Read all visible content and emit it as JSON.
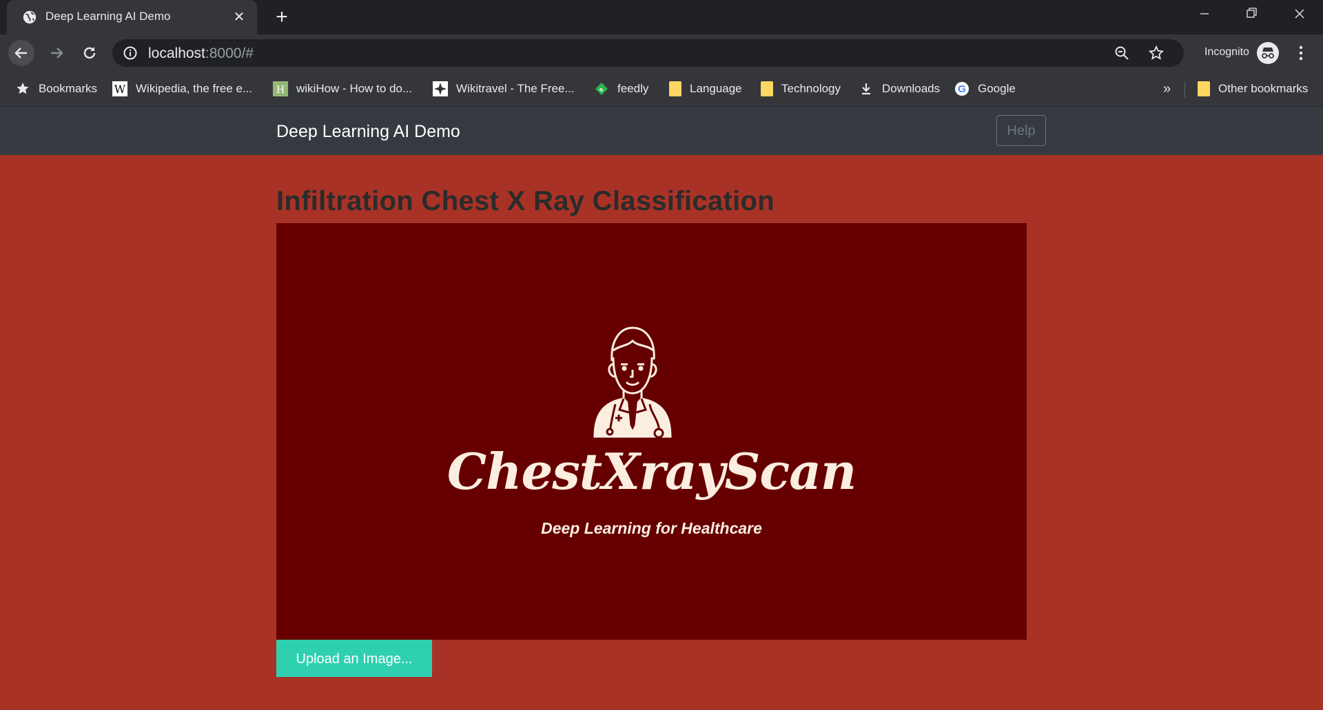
{
  "browser": {
    "tab_title": "Deep Learning AI Demo",
    "url_host": "localhost",
    "url_rest": ":8000/#",
    "incognito_label": "Incognito",
    "bookmarks": [
      {
        "label": "Bookmarks",
        "icon": "star-icon"
      },
      {
        "label": "Wikipedia, the free e...",
        "icon": "wikipedia-icon"
      },
      {
        "label": "wikiHow - How to do...",
        "icon": "wikihow-icon"
      },
      {
        "label": "Wikitravel - The Free...",
        "icon": "wikitravel-icon"
      },
      {
        "label": "feedly",
        "icon": "feedly-icon"
      },
      {
        "label": "Language",
        "icon": "folder-icon"
      },
      {
        "label": "Technology",
        "icon": "folder-icon"
      },
      {
        "label": "Downloads",
        "icon": "download-icon"
      },
      {
        "label": "Google",
        "icon": "google-icon"
      }
    ],
    "overflow_label": "»",
    "other_bookmarks": "Other bookmarks"
  },
  "navbar": {
    "brand": "Deep Learning AI Demo",
    "help_label": "Help"
  },
  "main": {
    "heading": "Infiltration Chest X Ray Classification",
    "logo_title": "ChestXrayScan",
    "logo_tagline": "Deep Learning for Healthcare",
    "upload_label": "Upload an Image..."
  },
  "colors": {
    "page_bg": "#a93226",
    "hero_bg": "#660000",
    "navbar_bg": "#343a40",
    "upload_btn": "#2fd0b0",
    "logo_ink": "#fbeee0"
  }
}
